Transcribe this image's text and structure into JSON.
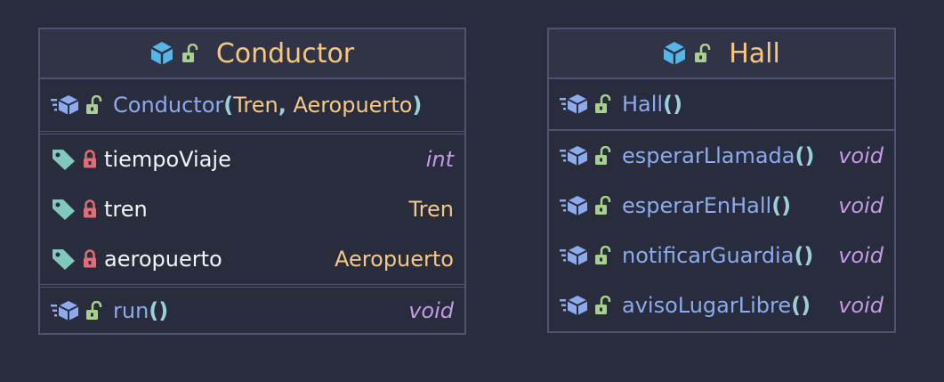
{
  "conductor": {
    "title": "Conductor",
    "constructor": {
      "name": "Conductor",
      "open": "(",
      "params": [
        "Tren",
        "Aeropuerto"
      ],
      "comma": ",",
      "close": ")"
    },
    "fields": [
      {
        "name": "tiempoViaje",
        "type": "int"
      },
      {
        "name": "tren",
        "type": "Tren"
      },
      {
        "name": "aeropuerto",
        "type": "Aeropuerto"
      }
    ],
    "methods": [
      {
        "name": "run",
        "parens": "()",
        "type": "void"
      }
    ]
  },
  "hall": {
    "title": "Hall",
    "constructor": {
      "name": "Hall",
      "parens": "()"
    },
    "methods": [
      {
        "name": "esperarLlamada",
        "parens": "()",
        "type": "void"
      },
      {
        "name": "esperarEnHall",
        "parens": "()",
        "type": "void"
      },
      {
        "name": "notificarGuardia",
        "parens": "()",
        "type": "void"
      },
      {
        "name": "avisoLugarLibre",
        "parens": "()",
        "type": "void"
      }
    ]
  },
  "colors": {
    "background": "#292c3c",
    "border": "#4f5371",
    "class_icon": "#56b6e8",
    "unlock": "#a6d189",
    "lock": "#e06c75",
    "tag": "#81c8be",
    "method_name": "#8caaee",
    "type": "#f4c988",
    "void": "#c39be6"
  },
  "icons": [
    "class-cube-icon",
    "unlocked-padlock-icon",
    "locked-padlock-icon",
    "tag-icon",
    "method-cube-icon"
  ]
}
